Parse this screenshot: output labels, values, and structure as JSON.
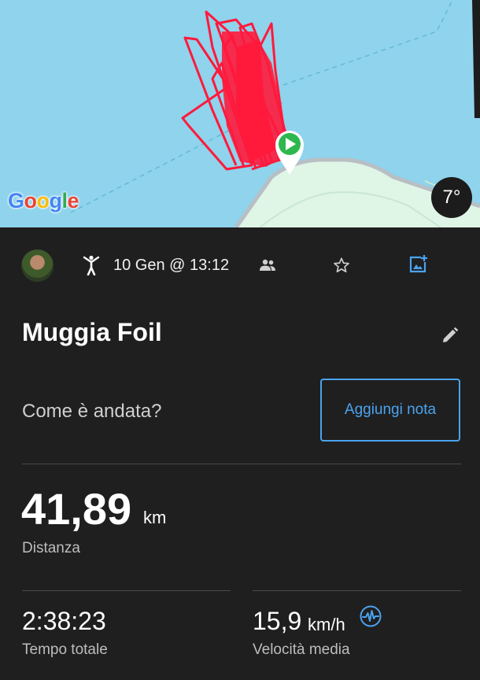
{
  "map": {
    "provider_logo": "Google",
    "temperature": "7°",
    "colors": {
      "water": "#8fd3ec",
      "land": "#dff5e6",
      "track": "#ff1a3c",
      "start_marker": "#2db84d"
    },
    "icons": [
      "start-marker-icon"
    ]
  },
  "header": {
    "activity_icon": "sailing-person-icon",
    "date": "10 Gen @ 13:12",
    "icons": [
      "people-icon",
      "star-icon",
      "add-photo-icon"
    ]
  },
  "activity": {
    "title": "Muggia Foil",
    "edit_icon": "pencil-icon"
  },
  "note": {
    "prompt": "Come è andata?",
    "button_label": "Aggiungi nota"
  },
  "stats": {
    "distance": {
      "value": "41,89",
      "unit": "km",
      "label": "Distanza"
    },
    "total_time": {
      "value": "2:38:23",
      "label": "Tempo totale"
    },
    "avg_speed": {
      "value": "15,9",
      "unit": "km/h",
      "label": "Velocità media",
      "icon": "pulse-icon"
    }
  },
  "accent_color": "#4aa3f0"
}
